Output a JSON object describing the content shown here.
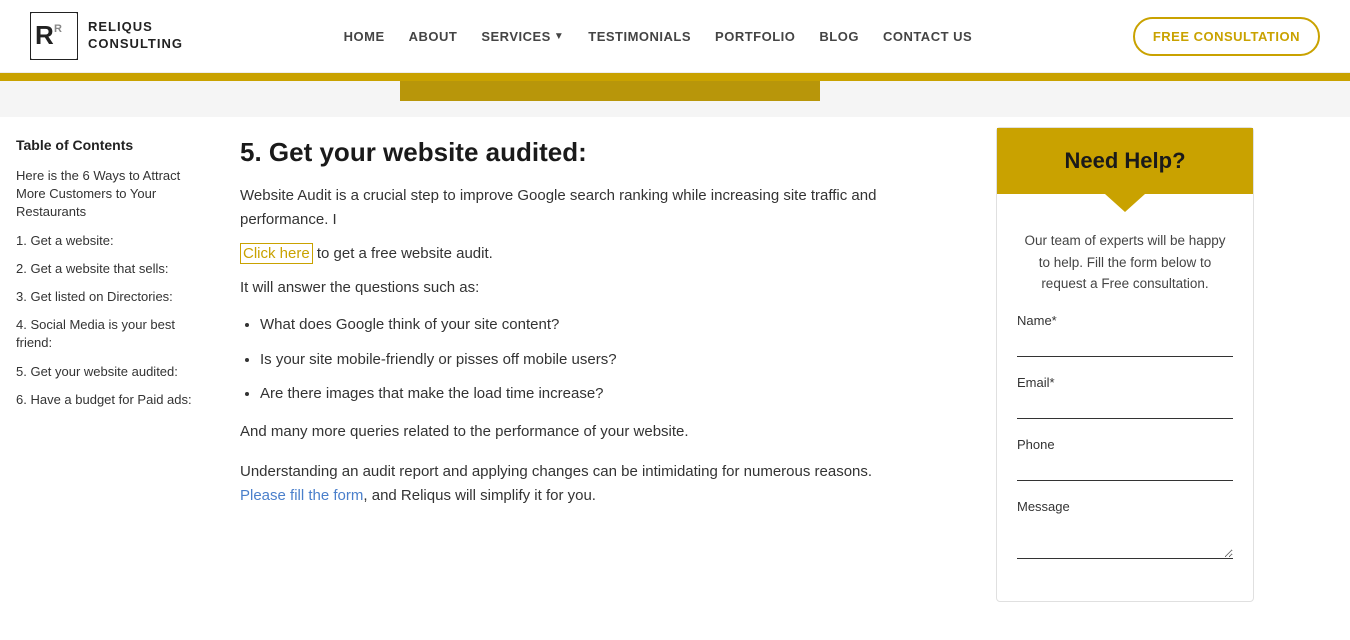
{
  "header": {
    "logo_line1": "RELIQUS",
    "logo_line2": "CONSULTING",
    "nav_items": [
      {
        "label": "HOME",
        "id": "home"
      },
      {
        "label": "ABOUT",
        "id": "about"
      },
      {
        "label": "SERVICES",
        "id": "services",
        "has_dropdown": true
      },
      {
        "label": "TESTIMONIALS",
        "id": "testimonials"
      },
      {
        "label": "PORTFOLIO",
        "id": "portfolio"
      },
      {
        "label": "BLOG",
        "id": "blog"
      },
      {
        "label": "CONTACT US",
        "id": "contact"
      }
    ],
    "cta_label": "FREE CONSULTATION"
  },
  "sidebar": {
    "toc_title": "Table of Contents",
    "items": [
      {
        "label": "Here is the 6 Ways to Attract More Customers to Your Restaurants",
        "id": "toc-intro"
      },
      {
        "label": "1. Get a website:",
        "id": "toc-1"
      },
      {
        "label": "2. Get a website that sells:",
        "id": "toc-2"
      },
      {
        "label": "3. Get listed on Directories:",
        "id": "toc-3"
      },
      {
        "label": "4. Social Media is your best friend:",
        "id": "toc-4"
      },
      {
        "label": "5. Get your website audited:",
        "id": "toc-5"
      },
      {
        "label": "6. Have a budget for Paid ads:",
        "id": "toc-6"
      }
    ]
  },
  "main": {
    "section_title": "5. Get your website audited:",
    "intro_text": "Website Audit is a crucial step to improve Google search ranking while increasing site traffic and performance. I",
    "click_here_label": "Click here",
    "after_click": " to get a free website audit.",
    "it_will": "It will answer the questions such as:",
    "questions": [
      "What does Google think of your site content?",
      "Is your site mobile-friendly or pisses off mobile users?",
      "Are there images that make the load time increase?"
    ],
    "and_more": "And many more queries related to the performance of your website.",
    "understanding_line1": "Understanding an audit report and applying changes can be intimidating for numerous reasons.",
    "please_label": "Please fill the form",
    "after_please": ", and Reliqus will simplify it for you."
  },
  "right_panel": {
    "card_title": "Need Help?",
    "card_desc": "Our team of experts will be happy to help. Fill the form below to request a Free consultation.",
    "fields": [
      {
        "label": "Name*",
        "type": "text",
        "id": "name"
      },
      {
        "label": "Email*",
        "type": "email",
        "id": "email"
      },
      {
        "label": "Phone",
        "type": "tel",
        "id": "phone"
      },
      {
        "label": "Message",
        "type": "textarea",
        "id": "message"
      }
    ]
  }
}
